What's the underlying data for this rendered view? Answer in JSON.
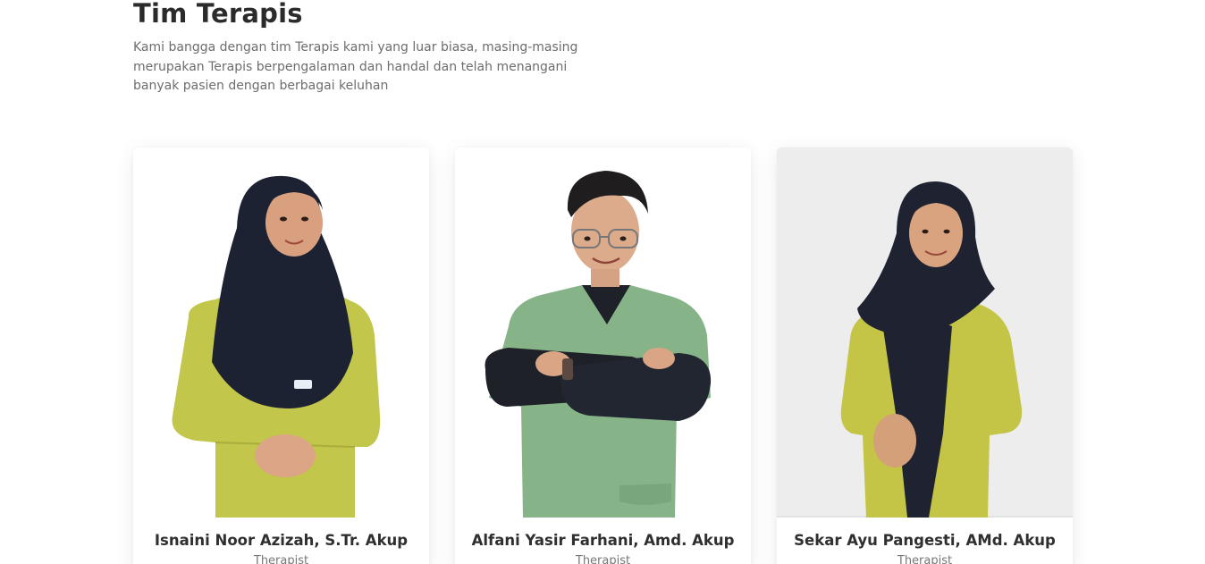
{
  "section": {
    "title": "Tim Terapis",
    "description": "Kami bangga dengan tim Terapis kami yang luar biasa, masing-masing merupakan Terapis berpengalaman dan handal dan telah menangani banyak pasien dengan berbagai keluhan"
  },
  "therapists": [
    {
      "name": "Isnaini Noor Azizah, S.Tr. Akup",
      "role": "Therapist"
    },
    {
      "name": "Alfani Yasir Farhani, Amd. Akup",
      "role": "Therapist"
    },
    {
      "name": "Sekar Ayu Pangesti, AMd. Akup",
      "role": "Therapist"
    }
  ],
  "colors": {
    "uniform_yellow": "#c2c64a",
    "uniform_green": "#86b488",
    "hijab_navy": "#1d2233",
    "skin": "#d9a07f",
    "photo_bg_gray": "#ededed"
  }
}
